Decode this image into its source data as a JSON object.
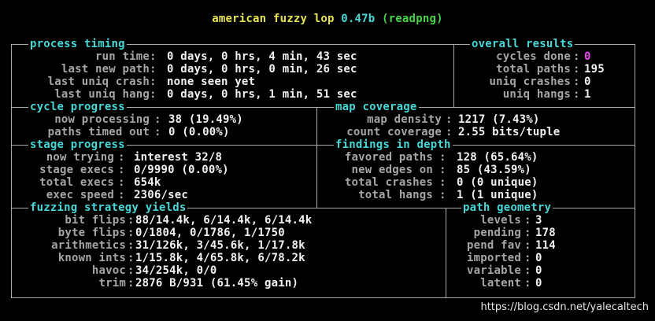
{
  "title": {
    "app": "american fuzzy lop",
    "version": "0.47b",
    "target": "(readpng)"
  },
  "colors": {
    "background": "#000000",
    "label": "#a6a6a6",
    "value": "#f2f2f2",
    "header": "#47d7d7",
    "title": "#e7e453",
    "target": "#47d447",
    "cycles": "#e94ae9",
    "border": "#a9a9a9"
  },
  "sections": {
    "process_timing": {
      "header": "process timing",
      "rows": [
        {
          "label": "run time",
          "value": "0 days, 0 hrs, 4 min, 43 sec"
        },
        {
          "label": "last new path",
          "value": "0 days, 0 hrs, 0 min, 26 sec"
        },
        {
          "label": "last uniq crash",
          "value": "none seen yet"
        },
        {
          "label": "last uniq hang",
          "value": "0 days, 0 hrs, 1 min, 51 sec"
        }
      ]
    },
    "overall_results": {
      "header": "overall results",
      "rows": [
        {
          "label": "cycles done",
          "value": "0"
        },
        {
          "label": "total paths",
          "value": "195"
        },
        {
          "label": "uniq crashes",
          "value": "0"
        },
        {
          "label": "uniq hangs",
          "value": "1"
        }
      ]
    },
    "cycle_progress": {
      "header": "cycle progress",
      "rows": [
        {
          "label": "now processing",
          "value": "38 (19.49%)"
        },
        {
          "label": "paths timed out",
          "value": "0 (0.00%)"
        }
      ]
    },
    "map_coverage": {
      "header": "map coverage",
      "rows": [
        {
          "label": "map density",
          "value": "1217 (7.43%)"
        },
        {
          "label": "count coverage",
          "value": "2.55 bits/tuple"
        }
      ]
    },
    "stage_progress": {
      "header": "stage progress",
      "rows": [
        {
          "label": "now trying",
          "value": "interest 32/8"
        },
        {
          "label": "stage execs",
          "value": "0/9990 (0.00%)"
        },
        {
          "label": "total execs",
          "value": "654k"
        },
        {
          "label": "exec speed",
          "value": "2306/sec"
        }
      ]
    },
    "findings_in_depth": {
      "header": "findings in depth",
      "rows": [
        {
          "label": "favored paths",
          "value": "128 (65.64%)"
        },
        {
          "label": "new edges on",
          "value": "85 (43.59%)"
        },
        {
          "label": "total crashes",
          "value": "0 (0 unique)"
        },
        {
          "label": "total hangs",
          "value": "1 (1 unique)"
        }
      ]
    },
    "fuzzing_strategy_yields": {
      "header": "fuzzing strategy yields",
      "rows": [
        {
          "label": "bit flips",
          "value": "88/14.4k, 6/14.4k, 6/14.4k"
        },
        {
          "label": "byte flips",
          "value": "0/1804, 0/1786, 1/1750"
        },
        {
          "label": "arithmetics",
          "value": "31/126k, 3/45.6k, 1/17.8k"
        },
        {
          "label": "known ints",
          "value": "1/15.8k, 4/65.8k, 6/78.2k"
        },
        {
          "label": "havoc",
          "value": "34/254k, 0/0"
        },
        {
          "label": "trim",
          "value": "2876 B/931 (61.45% gain)"
        }
      ]
    },
    "path_geometry": {
      "header": "path geometry",
      "rows": [
        {
          "label": "levels",
          "value": "3"
        },
        {
          "label": "pending",
          "value": "178"
        },
        {
          "label": "pend fav",
          "value": "114"
        },
        {
          "label": "imported",
          "value": "0"
        },
        {
          "label": "variable",
          "value": "0"
        },
        {
          "label": "latent",
          "value": "0"
        }
      ]
    }
  },
  "watermark": "https://blog.csdn.net/yalecaltech"
}
